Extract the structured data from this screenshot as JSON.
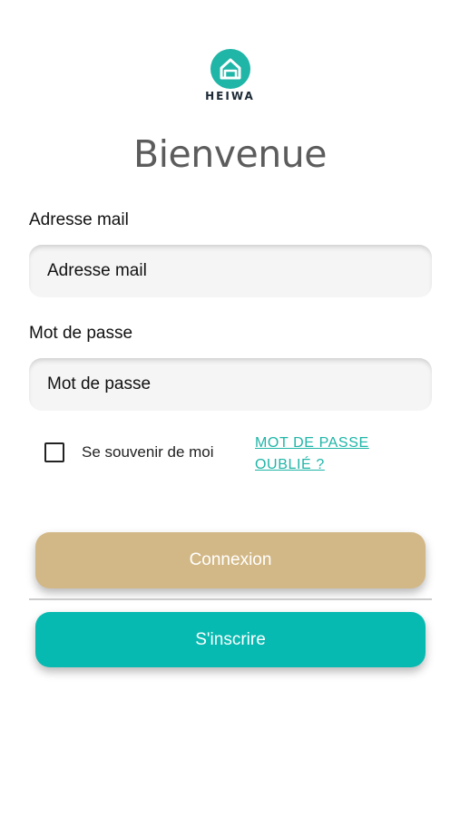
{
  "logo": {
    "brand": "HEIWA",
    "icon": "house-icon",
    "color": "#1fb5a7"
  },
  "title": "Bienvenue",
  "email": {
    "label": "Adresse mail",
    "placeholder": "Adresse mail",
    "value": ""
  },
  "password": {
    "label": "Mot de passe",
    "placeholder": "Mot de passe",
    "value": ""
  },
  "remember": {
    "label": "Se souvenir de moi",
    "checked": false
  },
  "forgot": {
    "line1": "MOT DE PASSE",
    "line2": "OUBLIÉ ?"
  },
  "buttons": {
    "login": {
      "label": "Connexion",
      "color": "#d3b887"
    },
    "signup": {
      "label": "S'inscrire",
      "color": "#07bab1"
    }
  }
}
